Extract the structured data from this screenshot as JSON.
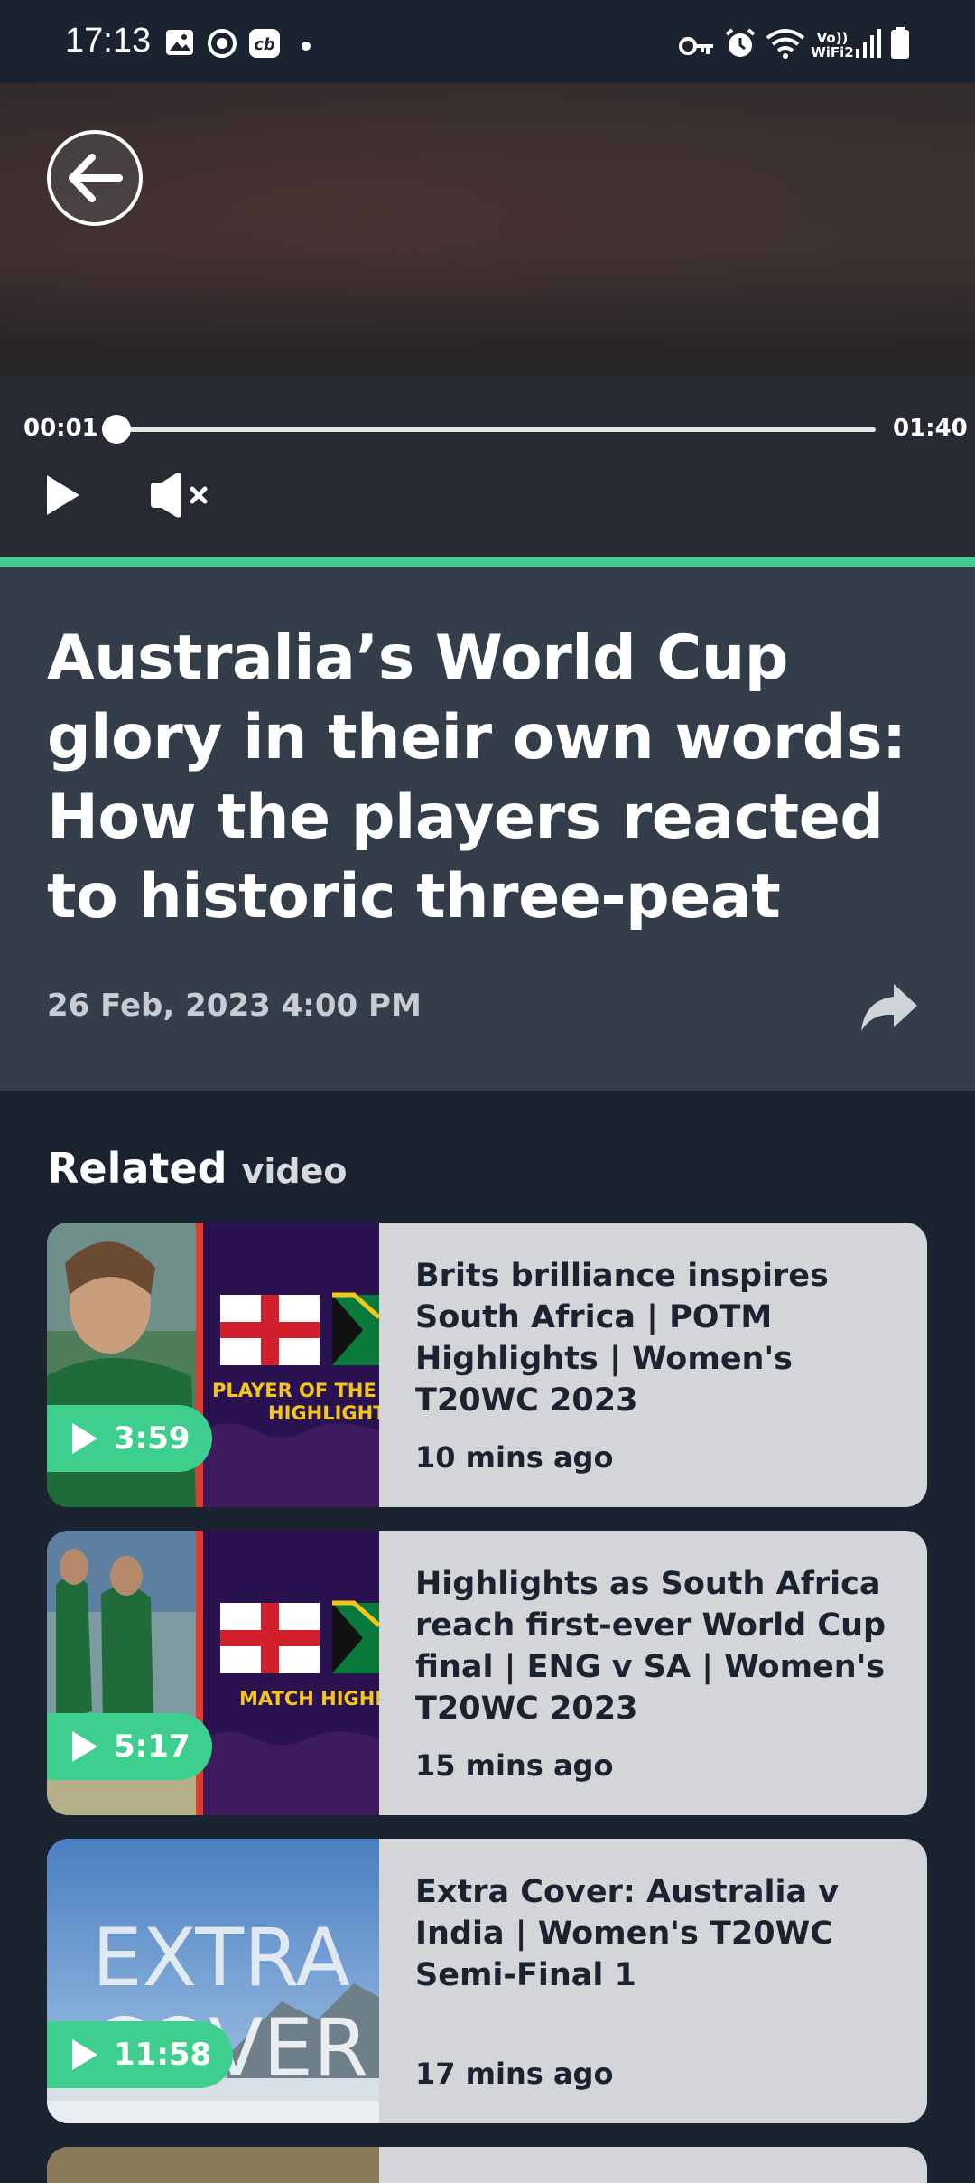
{
  "status_bar": {
    "time": "17:13",
    "wifi_label_top": "Vo))",
    "wifi_label_bottom": "WiFi2",
    "icons": [
      "gallery-icon",
      "sync-icon",
      "cb-app-icon",
      "dot-icon",
      "key-icon",
      "alarm-icon",
      "wifi-icon",
      "signal-icon",
      "battery-icon"
    ]
  },
  "player": {
    "current_time": "00:01",
    "duration": "01:40",
    "progress": 0.01
  },
  "article": {
    "title": "Australia’s World Cup glory in their own words: How the players reacted to historic three-peat",
    "date": "26 Feb, 2023 4:00 PM"
  },
  "related": {
    "heading": "Related",
    "heading_sub": "video",
    "items": [
      {
        "title": "Brits brilliance inspires South Africa | POTM Highlights | Women's T20WC 2023",
        "time": "10 mins ago",
        "duration": "3:59",
        "thumb_text_1": "PLAYER OF THE",
        "thumb_text_2": "HIGHLIGHT"
      },
      {
        "title": "Highlights as South Africa reach first-ever World Cup final | ENG v SA | Women's T20WC 2023",
        "time": "15 mins ago",
        "duration": "5:17",
        "thumb_text_1": "MATCH HIGHLI"
      },
      {
        "title": "Extra Cover: Australia v India | Women's T20WC Semi-Final 1",
        "time": "17 mins ago",
        "duration": "11:58",
        "thumb_text_1": "EXTRA",
        "thumb_text_2": "COVER"
      }
    ]
  },
  "colors": {
    "accent": "#3ecf8e",
    "background": "#1b2230",
    "article_bg": "#343d4a",
    "card_bg": "#d4d5d8"
  }
}
